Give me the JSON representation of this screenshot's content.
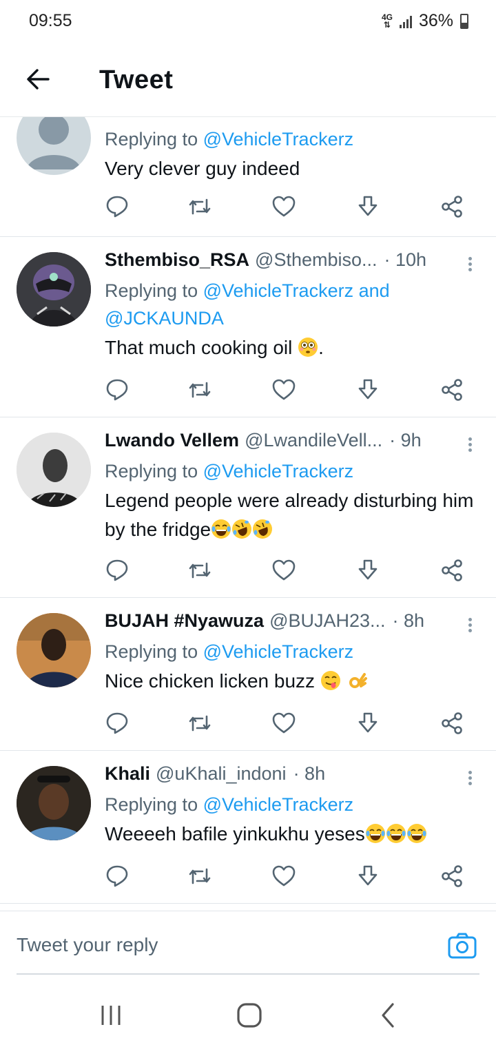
{
  "status": {
    "time": "09:55",
    "network": "4G",
    "battery": "36%"
  },
  "appbar": {
    "title": "Tweet"
  },
  "tweets": [
    {
      "name": "",
      "handle": "",
      "time": "",
      "replying_prefix": "Replying to ",
      "mentions": "@VehicleTrackerz",
      "mentions_line2": "",
      "text": "Very clever guy indeed",
      "emojis": [],
      "avatar": "default"
    },
    {
      "name": "Sthembiso_RSA",
      "handle": "@Sthembiso...",
      "time": "· 10h",
      "replying_prefix": "Replying to ",
      "mentions": "@VehicleTrackerz and",
      "mentions_line2": "@JCKAUNDA",
      "text": "That much cooking oil",
      "text_suffix": ".",
      "emojis": [
        "flushed"
      ],
      "avatar": "helmet"
    },
    {
      "name": "Lwando Vellem",
      "handle": "@LwandileVell...",
      "time": "· 9h",
      "replying_prefix": "Replying to ",
      "mentions": "@VehicleTrackerz",
      "mentions_line2": "",
      "text": "Legend people were already disturbing him by the fridge",
      "emojis": [
        "joy",
        "rofl",
        "rofl"
      ],
      "avatar": "person-bw"
    },
    {
      "name": "BUJAH #Nyawuza",
      "handle": "@BUJAH23...",
      "time": "· 8h",
      "replying_prefix": "Replying to ",
      "mentions": "@VehicleTrackerz",
      "mentions_line2": "",
      "text": "Nice chicken licken buzz",
      "emojis": [
        "yum",
        "ok-hand"
      ],
      "avatar": "person-color"
    },
    {
      "name": "Khali",
      "handle": "@uKhali_indoni",
      "time": "· 8h",
      "replying_prefix": "Replying to ",
      "mentions": "@VehicleTrackerz",
      "mentions_line2": "",
      "text": "Weeeeh bafile yinkukhu yeses",
      "emojis": [
        "joy",
        "joy",
        "joy"
      ],
      "avatar": "person-dark"
    }
  ],
  "reply_bar": {
    "placeholder": "Tweet your reply"
  },
  "colors": {
    "accent": "#1d9bf0",
    "secondary_text": "#536471",
    "divider": "#e1e6ea"
  },
  "icons": [
    "back-arrow-icon",
    "reply-icon",
    "retweet-icon",
    "like-icon",
    "download-icon",
    "share-icon",
    "camera-icon",
    "more-icon",
    "recent-apps-icon",
    "home-icon",
    "nav-back-icon"
  ]
}
